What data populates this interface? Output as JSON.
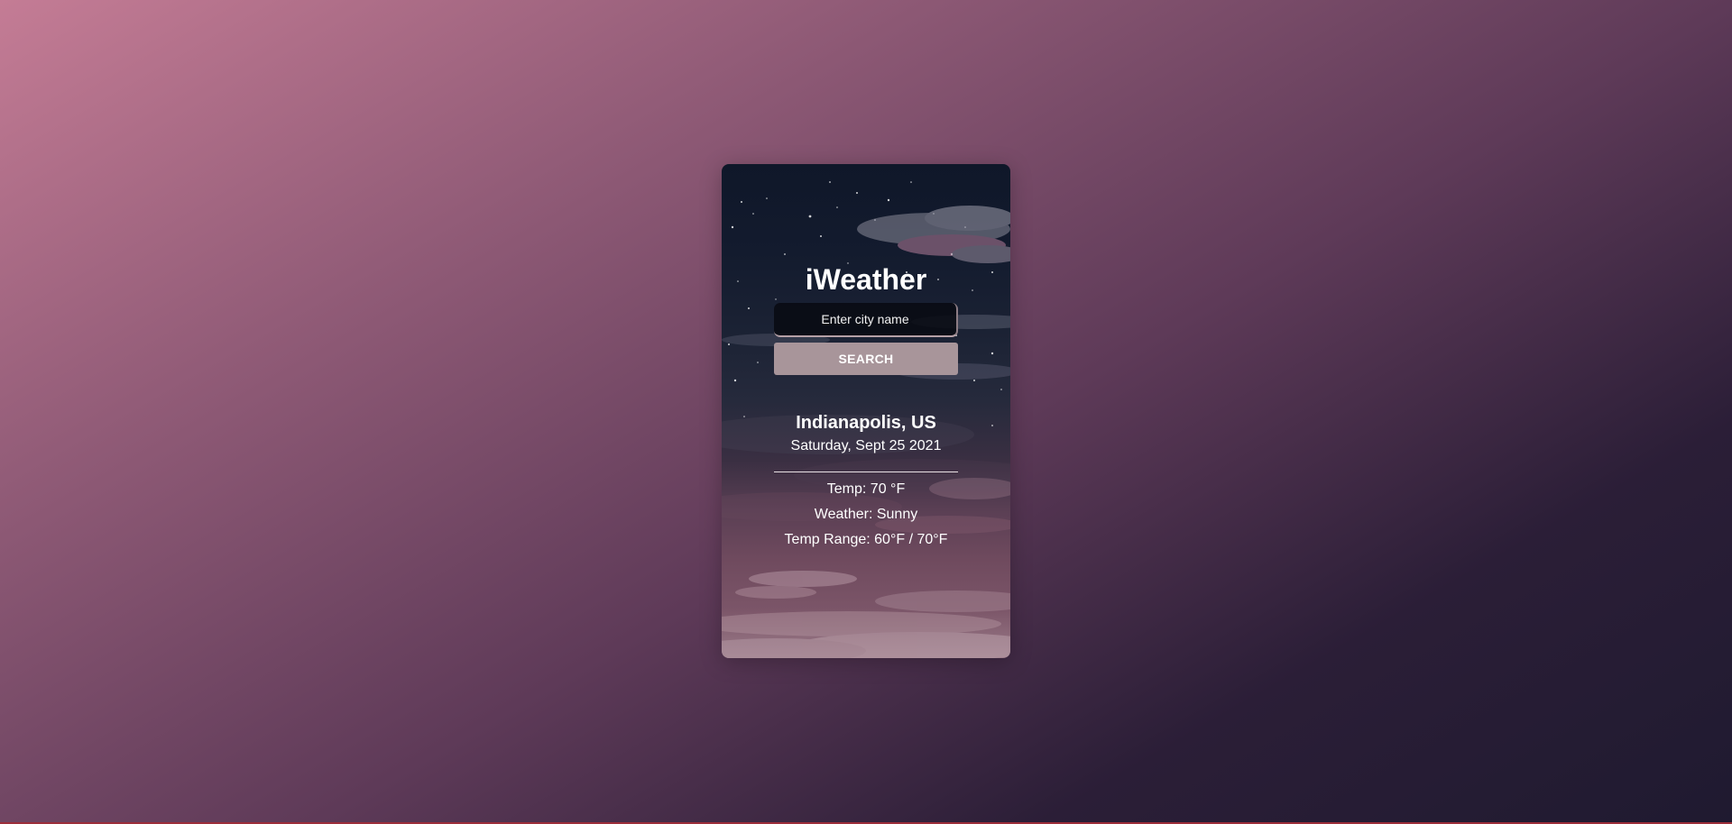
{
  "app": {
    "title": "iWeather"
  },
  "search": {
    "placeholder": "Enter city name",
    "button_label": "SEARCH"
  },
  "weather": {
    "location": "Indianapolis, US",
    "date": "Saturday, Sept 25 2021",
    "temp": "Temp: 70 °F",
    "condition": "Weather: Sunny",
    "temp_range": "Temp Range: 60°F / 70°F"
  },
  "colors": {
    "background_start": "#c47c95",
    "background_end": "#1f1a30",
    "search_button": "#a8959a",
    "bottom_line": "#9c2e3a"
  }
}
